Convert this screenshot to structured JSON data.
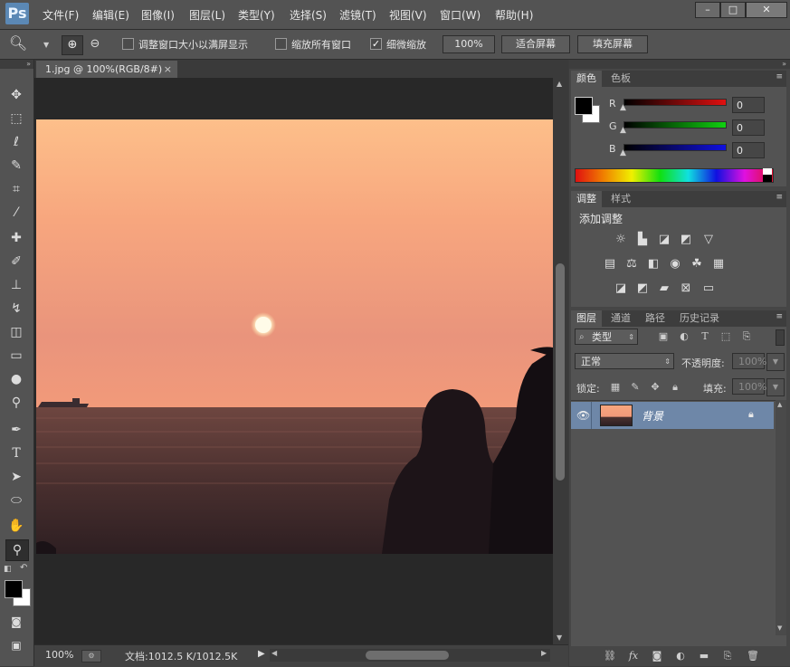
{
  "app": {
    "logo": "Ps"
  },
  "menu": [
    "文件(F)",
    "编辑(E)",
    "图像(I)",
    "图层(L)",
    "类型(Y)",
    "选择(S)",
    "滤镜(T)",
    "视图(V)",
    "窗口(W)",
    "帮助(H)"
  ],
  "options_bar": {
    "resize_windows_label": "调整窗口大小以满屏显示",
    "zoom_all_label": "缩放所有窗口",
    "scrubby_zoom_label": "细微缩放",
    "zoom_100_label": "100%",
    "fit_screen_label": "适合屏幕",
    "fill_screen_label": "填充屏幕",
    "scrubby_zoom_checked": true
  },
  "document": {
    "tab_title": "1.jpg @ 100%(RGB/8#)",
    "status_zoom": "100%",
    "status_doc": "文档:1012.5 K/1012.5K"
  },
  "color_panel": {
    "tabs": [
      "颜色",
      "色板"
    ],
    "channels": [
      {
        "label": "R",
        "value": "0",
        "color": "#e01010"
      },
      {
        "label": "G",
        "value": "0",
        "color": "#10c010"
      },
      {
        "label": "B",
        "value": "0",
        "color": "#1010d0"
      }
    ]
  },
  "adjust_panel": {
    "tabs": [
      "调整",
      "样式"
    ],
    "title": "添加调整"
  },
  "layers_panel": {
    "tabs": [
      "图层",
      "通道",
      "路径",
      "历史记录"
    ],
    "filter_label": "类型",
    "blend_mode": "正常",
    "opacity_label": "不透明度:",
    "opacity_value": "100%",
    "lock_label": "锁定:",
    "fill_label": "填充:",
    "fill_value": "100%",
    "layer": {
      "name": "背景"
    }
  },
  "colors": {
    "foreground": "#000000",
    "background": "#ffffff",
    "accent": "#6e87a8"
  }
}
